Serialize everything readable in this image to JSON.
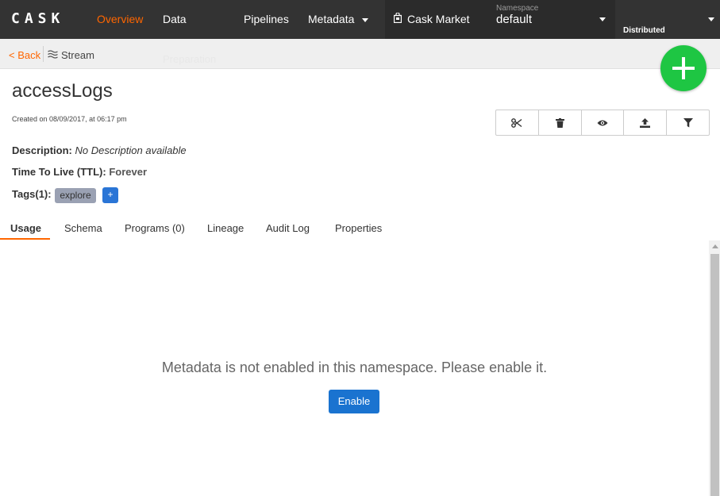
{
  "brand": {
    "logo": "CASK"
  },
  "nav": {
    "overview": "Overview",
    "data": "Data",
    "data_overflow": "Preparation",
    "pipelines": "Pipelines",
    "metadata": "Metadata",
    "market": "Cask Market",
    "namespace_label": "Namespace",
    "namespace_value": "default",
    "mode": "Distributed"
  },
  "breadcrumb": {
    "back": "< Back",
    "current": "Stream"
  },
  "entity": {
    "name": "accessLogs",
    "created": "Created on 08/09/2017, at 06:17 pm",
    "description_label": "Description:",
    "description_value": "No Description available",
    "ttl_label": "Time To Live (TTL):",
    "ttl_value": "Forever",
    "tags_label": "Tags(1):",
    "tags": [
      "explore"
    ],
    "add_tag": "+"
  },
  "actions": [
    "scissors-icon",
    "trash-icon",
    "eye-icon",
    "upload-icon",
    "filter-icon"
  ],
  "tabs": [
    "Usage",
    "Schema",
    "Programs (0)",
    "Lineage",
    "Audit Log",
    "Properties"
  ],
  "active_tab": "Usage",
  "content": {
    "message": "Metadata is not enabled in this namespace. Please enable it.",
    "enable_button": "Enable"
  },
  "colors": {
    "accent": "#ff6600",
    "fab": "#1ec643",
    "primary": "#1a73d0",
    "topbar": "#333333"
  }
}
